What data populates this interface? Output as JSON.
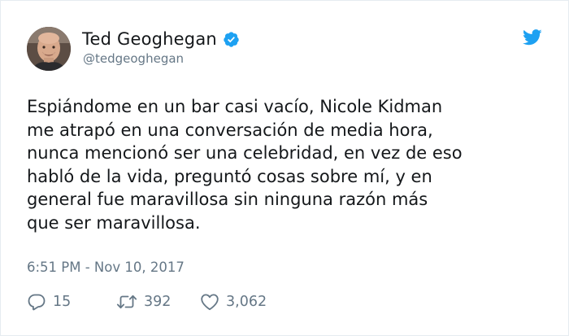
{
  "author": {
    "display_name": "Ted Geoghegan",
    "handle": "@tedgeoghegan",
    "verified": true,
    "avatar_icon": "profile-photo"
  },
  "tweet": {
    "lines": [
      "Espiándome en un bar casi vacío, Nicole Kidman",
      "me atrapó en una conversación de media hora,",
      "nunca mencionó ser una celebridad, en vez de eso",
      "habló de la vida, preguntó cosas sobre mí, y en",
      "general fue maravillosa sin ninguna razón más",
      "que ser maravillosa."
    ],
    "timestamp": "6:51 PM - Nov 10, 2017"
  },
  "actions": {
    "replies": "15",
    "retweets": "392",
    "likes": "3,062"
  },
  "colors": {
    "twitter_blue": "#1da1f2",
    "text": "#14171a",
    "muted": "#657786",
    "border": "#e6ecf0"
  },
  "icons": {
    "brand": "twitter-bird-icon",
    "verified": "verified-badge-icon",
    "reply": "reply-icon",
    "retweet": "retweet-icon",
    "like": "heart-icon"
  }
}
